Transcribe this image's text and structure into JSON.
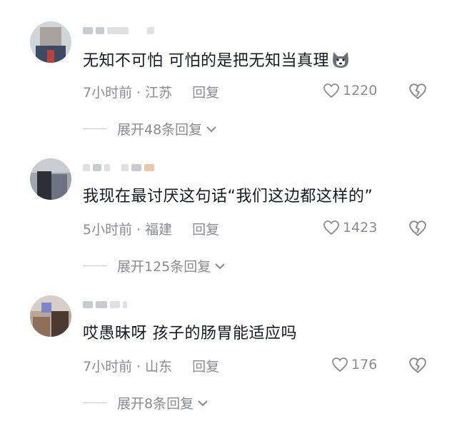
{
  "icons": {
    "like": "heart-outline-icon",
    "dislike": "broken-heart-icon",
    "expand": "chevron-down-icon",
    "emoji": "husky-dog-emoji-icon"
  },
  "colors": {
    "text": "#161823",
    "meta": "#8a8b91"
  },
  "comments": [
    {
      "username": "",
      "text": "无知不可怕 可怕的是把无知当真理",
      "time": "7小时前",
      "location": "江苏",
      "reply_label": "回复",
      "likes": "1220",
      "expand_label": "展开48条回复"
    },
    {
      "username": "",
      "text": "我现在最讨厌这句话“我们这边都这样的”",
      "time": "5小时前",
      "location": "福建",
      "reply_label": "回复",
      "likes": "1423",
      "expand_label": "展开125条回复"
    },
    {
      "username": "",
      "text": "哎愚昧呀  孩子的肠胃能适应吗",
      "time": "7小时前",
      "location": "山东",
      "reply_label": "回复",
      "likes": "176",
      "expand_label": "展开8条回复"
    }
  ]
}
